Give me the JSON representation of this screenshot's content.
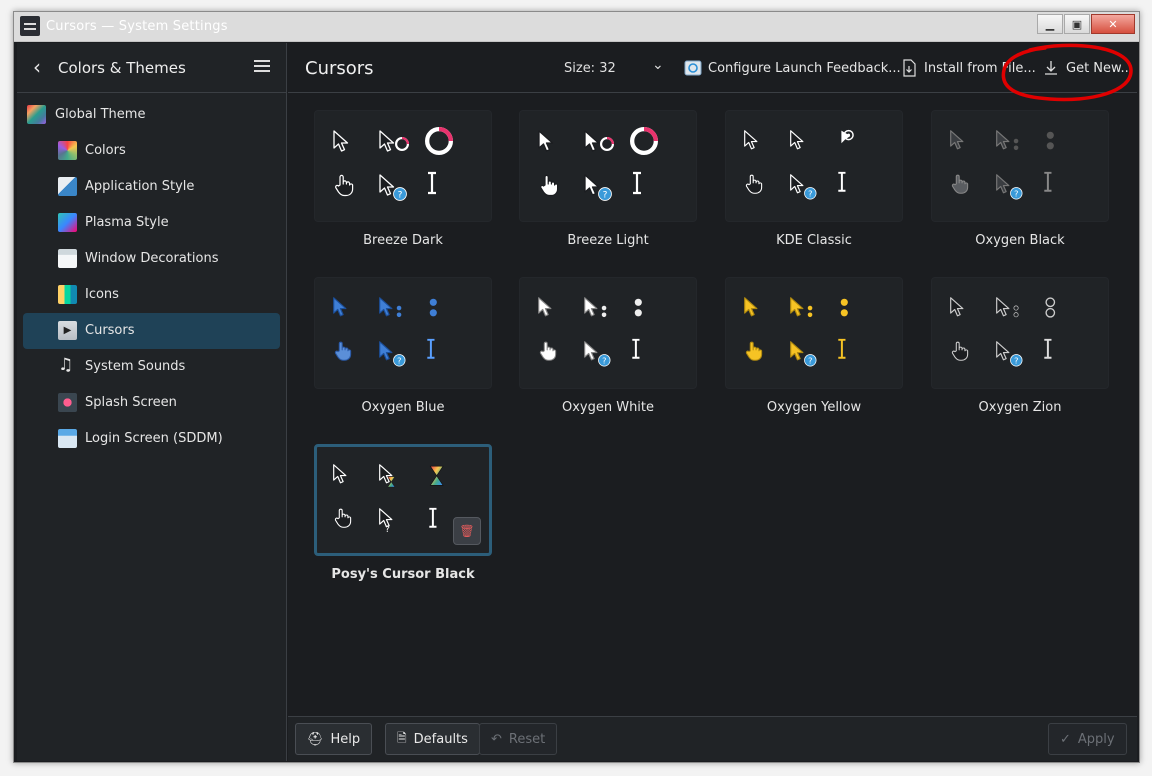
{
  "window": {
    "title": "Cursors — System Settings"
  },
  "sidebar": {
    "title": "Colors & Themes",
    "items": [
      {
        "label": "Global Theme",
        "icon": "global-theme-icon",
        "level": "top"
      },
      {
        "label": "Colors",
        "icon": "colors-icon",
        "level": "sub"
      },
      {
        "label": "Application Style",
        "icon": "application-style-icon",
        "level": "sub"
      },
      {
        "label": "Plasma Style",
        "icon": "plasma-style-icon",
        "level": "sub"
      },
      {
        "label": "Window Decorations",
        "icon": "window-decorations-icon",
        "level": "sub"
      },
      {
        "label": "Icons",
        "icon": "icons-icon",
        "level": "sub"
      },
      {
        "label": "Cursors",
        "icon": "cursors-icon",
        "level": "sub",
        "active": true
      },
      {
        "label": "System Sounds",
        "icon": "music-note-icon",
        "level": "sub"
      },
      {
        "label": "Splash Screen",
        "icon": "splash-screen-icon",
        "level": "sub"
      },
      {
        "label": "Login Screen (SDDM)",
        "icon": "login-screen-icon",
        "level": "sub"
      }
    ]
  },
  "header": {
    "title": "Cursors",
    "size_label": "Size: 32",
    "configure_label": "Configure Launch Feedback...",
    "install_label": "Install from File...",
    "get_new_label": "Get New..."
  },
  "themes": [
    {
      "name": "Breeze Dark",
      "style": "breeze-dark"
    },
    {
      "name": "Breeze Light",
      "style": "breeze-light"
    },
    {
      "name": "KDE Classic",
      "style": "kde-classic"
    },
    {
      "name": "Oxygen Black",
      "style": "oxygen-black"
    },
    {
      "name": "Oxygen Blue",
      "style": "oxygen-blue"
    },
    {
      "name": "Oxygen White",
      "style": "oxygen-white"
    },
    {
      "name": "Oxygen Yellow",
      "style": "oxygen-yellow"
    },
    {
      "name": "Oxygen Zion",
      "style": "oxygen-zion"
    },
    {
      "name": "Posy's Cursor Black",
      "style": "posy",
      "selected": true
    }
  ],
  "footer": {
    "help_label": "Help",
    "defaults_label": "Defaults",
    "reset_label": "Reset",
    "apply_label": "Apply"
  },
  "colors": {
    "accent": "#1f4257",
    "annotation": "#e00000",
    "selected_border": "#2c5e7a"
  }
}
